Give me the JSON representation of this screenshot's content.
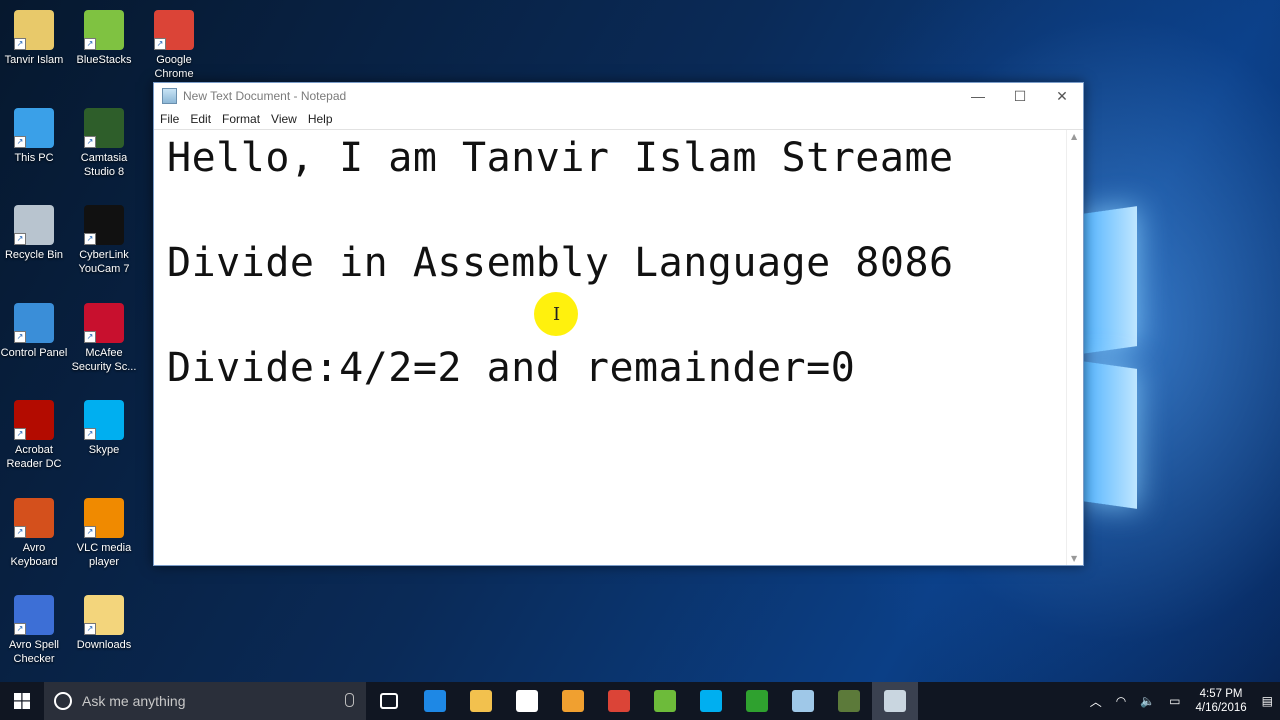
{
  "desktop": {
    "icons": [
      {
        "label": "Tanvir Islam",
        "icon": "user-folder-icon",
        "color": "#e8c96a"
      },
      {
        "label": "BlueStacks",
        "icon": "bluestacks-icon",
        "color": "#7fc241"
      },
      {
        "label": "Google Chrome",
        "icon": "chrome-icon",
        "color": "#db4437"
      },
      {
        "label": "This PC",
        "icon": "computer-icon",
        "color": "#3aa0e8"
      },
      {
        "label": "Camtasia Studio 8",
        "icon": "camtasia-icon",
        "color": "#2e5e2a"
      },
      {
        "label": "Recycle Bin",
        "icon": "recycle-bin-icon",
        "color": "#b8c4cf"
      },
      {
        "label": "CyberLink YouCam 7",
        "icon": "youcam-icon",
        "color": "#111111"
      },
      {
        "label": "Control Panel",
        "icon": "control-panel-icon",
        "color": "#3a8ed8"
      },
      {
        "label": "McAfee Security Sc...",
        "icon": "mcafee-icon",
        "color": "#c8102e"
      },
      {
        "label": "Acrobat Reader DC",
        "icon": "acrobat-icon",
        "color": "#b30b00"
      },
      {
        "label": "Skype",
        "icon": "skype-icon",
        "color": "#00aff0"
      },
      {
        "label": "Avro Keyboard",
        "icon": "avro-keyboard-icon",
        "color": "#d4501c"
      },
      {
        "label": "VLC media player",
        "icon": "vlc-icon",
        "color": "#f08a00"
      },
      {
        "label": "Avro Spell Checker",
        "icon": "spell-check-icon",
        "color": "#3d6fd6"
      },
      {
        "label": "Downloads",
        "icon": "folder-icon",
        "color": "#f3d57c"
      }
    ]
  },
  "notepad": {
    "title": "New Text Document - Notepad",
    "menu": [
      "File",
      "Edit",
      "Format",
      "View",
      "Help"
    ],
    "lines": [
      "Hello, I am Tanvir Islam Streame",
      "Divide in Assembly Language 8086",
      "Divide:4/2=2 and remainder=0"
    ],
    "controls": {
      "minimize": "—",
      "maximize": "☐",
      "close": "✕"
    }
  },
  "taskbar": {
    "search_placeholder": "Ask me anything",
    "pinned": [
      {
        "icon": "task-view-icon",
        "color": "#ffffff"
      },
      {
        "icon": "edge-icon",
        "color": "#1e88e5"
      },
      {
        "icon": "file-explorer-icon",
        "color": "#f2c14e"
      },
      {
        "icon": "store-icon",
        "color": "#ffffff"
      },
      {
        "icon": "media-player-icon",
        "color": "#f0a030"
      },
      {
        "icon": "chrome-icon",
        "color": "#db4437"
      },
      {
        "icon": "utorrent-icon",
        "color": "#6dbb3a"
      },
      {
        "icon": "skype-icon",
        "color": "#00aff0"
      },
      {
        "icon": "camtasia-recorder-icon",
        "color": "#2fa12f"
      },
      {
        "icon": "notepad-icon",
        "color": "#9fc8e8"
      },
      {
        "icon": "camtasia-studio-icon",
        "color": "#5c7a3a"
      },
      {
        "icon": "notepad-active-icon",
        "color": "#c9d6e0"
      }
    ],
    "clock": {
      "time": "4:57 PM",
      "date": "4/16/2016"
    }
  }
}
